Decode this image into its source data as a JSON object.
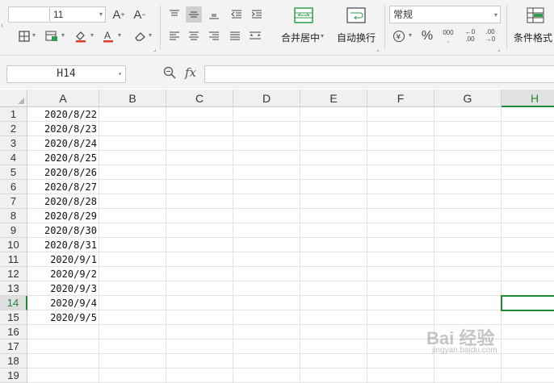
{
  "toolbar": {
    "font_size": "11",
    "number_format": "常规",
    "merge_center_label": "合并居中",
    "wrap_text_label": "自动换行",
    "conditional_format_label": "条件格式",
    "percent_symbol": "%",
    "thousands_symbol": "000",
    "increase_decimal": "←0 .00",
    "decrease_decimal": ".00 →0",
    "grow_font": "A⁺",
    "shrink_font": "A⁻",
    "currency_symbol": "¥"
  },
  "formula_bar": {
    "name_box": "H14",
    "fx_label": "fx",
    "formula": ""
  },
  "sheet": {
    "columns": [
      "A",
      "B",
      "C",
      "D",
      "E",
      "F",
      "G",
      "H"
    ],
    "selected_column": "H",
    "selected_row": "14",
    "rows": [
      "1",
      "2",
      "3",
      "4",
      "5",
      "6",
      "7",
      "8",
      "9",
      "10",
      "11",
      "12",
      "13",
      "14",
      "15",
      "16",
      "17",
      "18",
      "19"
    ],
    "column_a": [
      "2020/8/22",
      "2020/8/23",
      "2020/8/24",
      "2020/8/25",
      "2020/8/26",
      "2020/8/27",
      "2020/8/28",
      "2020/8/29",
      "2020/8/30",
      "2020/8/31",
      "2020/9/1",
      "2020/9/2",
      "2020/9/3",
      "2020/9/4",
      "2020/9/5"
    ]
  },
  "watermark": {
    "text": "Bai 经验",
    "url": "jingyan.baidu.com"
  }
}
